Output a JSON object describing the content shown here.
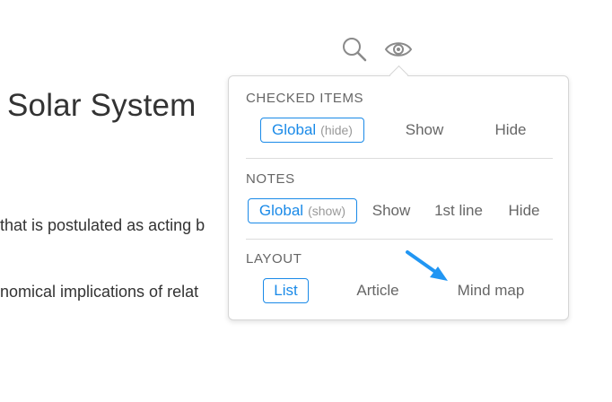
{
  "document": {
    "title": "Solar System",
    "line1": "that is postulated as acting b",
    "line2": "nomical implications of relat"
  },
  "toolbar": {
    "icons": [
      "search-icon",
      "eye-icon"
    ]
  },
  "popover": {
    "checked_items": {
      "title": "CHECKED ITEMS",
      "global_label": "Global",
      "global_hint": "(hide)",
      "show": "Show",
      "hide": "Hide",
      "selected": "Global"
    },
    "notes": {
      "title": "NOTES",
      "global_label": "Global",
      "global_hint": "(show)",
      "show": "Show",
      "first_line": "1st line",
      "hide": "Hide",
      "selected": "Global"
    },
    "layout": {
      "title": "LAYOUT",
      "list": "List",
      "article": "Article",
      "mind_map": "Mind map",
      "selected": "List"
    }
  },
  "colors": {
    "accent": "#1a8ae8",
    "annotation_arrow": "#2196f3",
    "muted_text": "#666666"
  }
}
